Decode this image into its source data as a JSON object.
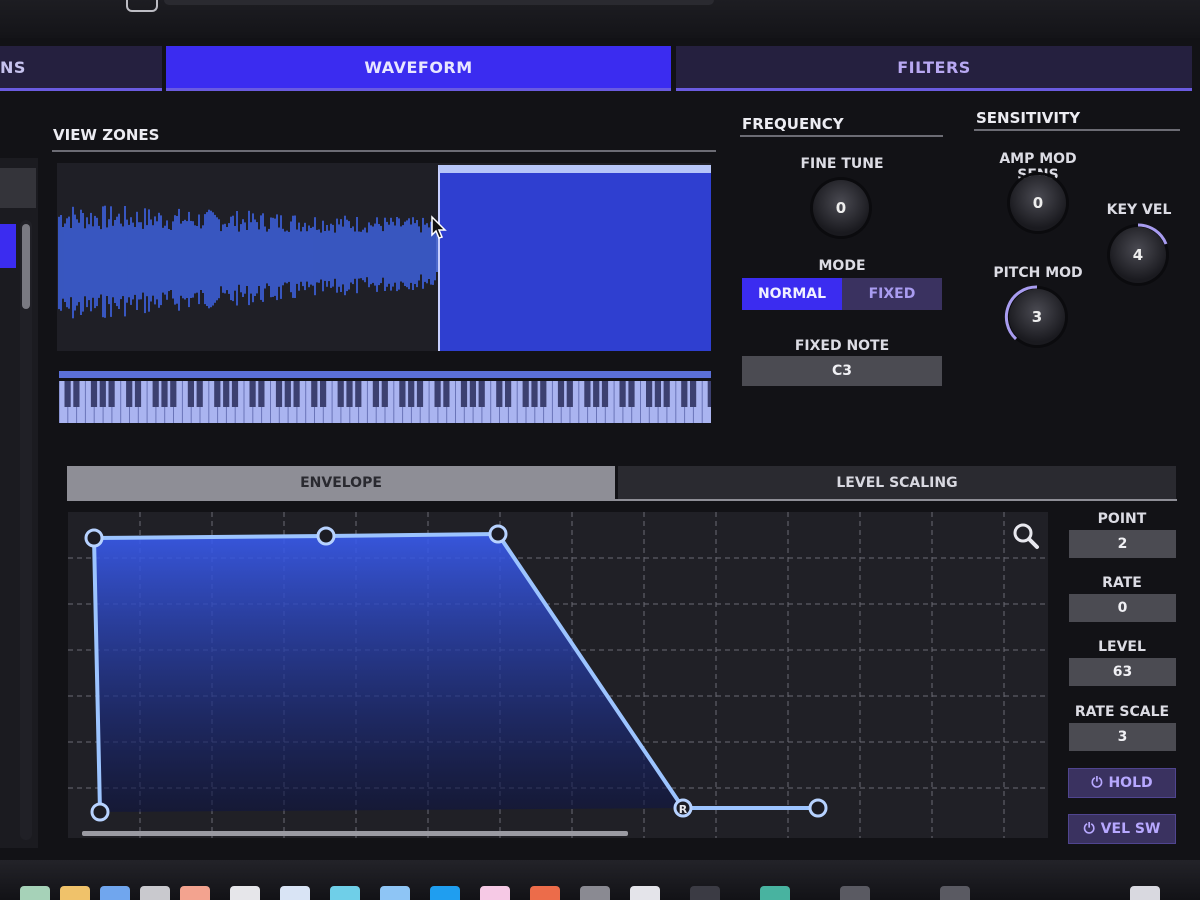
{
  "tabs": [
    {
      "label": "NS"
    },
    {
      "label": "WAVEFORM"
    },
    {
      "label": "FILTERS"
    }
  ],
  "view_zones": {
    "title": "VIEW ZONES"
  },
  "frequency": {
    "title": "FREQUENCY",
    "fine_tune_label": "FINE TUNE",
    "fine_tune_value": "0",
    "mode_label": "MODE",
    "mode_normal": "NORMAL",
    "mode_fixed": "FIXED",
    "fixed_note_label": "FIXED NOTE",
    "fixed_note_value": "C3"
  },
  "sensitivity": {
    "title": "SENSITIVITY",
    "amp_mod_label": "AMP MOD SENS",
    "amp_mod_value": "0",
    "key_vel_label": "KEY VEL",
    "key_vel_value": "4",
    "pitch_mod_label": "PITCH MOD",
    "pitch_mod_value": "3"
  },
  "lower_tabs": {
    "envelope": "ENVELOPE",
    "level_scaling": "LEVEL SCALING"
  },
  "envelope_params": {
    "point_label": "POINT",
    "point_value": "2",
    "rate_label": "RATE",
    "rate_value": "0",
    "level_label": "LEVEL",
    "level_value": "63",
    "rate_scale_label": "RATE SCALE",
    "rate_scale_value": "3",
    "hold_label": "HOLD",
    "vel_sw_label": "VEL SW"
  },
  "envelope_marker": "R",
  "icons": [
    "cursor-arrow-icon",
    "zoom-icon",
    "power-icon"
  ],
  "colors": {
    "accent": "#3b2cf0",
    "wave": "#3f64e6",
    "panel": "#121216"
  }
}
